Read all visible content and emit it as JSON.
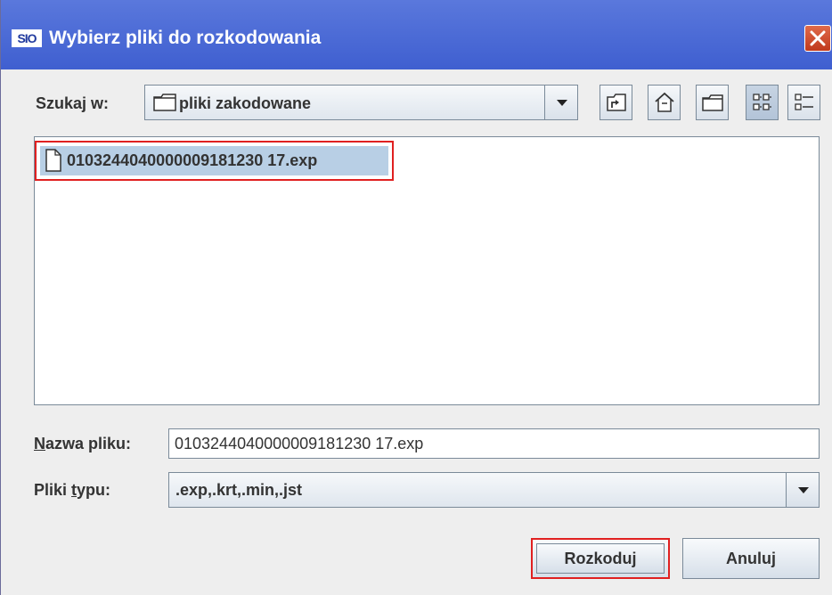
{
  "window": {
    "app_icon_text": "SIO",
    "title": "Wybierz pliki do rozkodowania"
  },
  "lookin": {
    "label": "Szukaj w:",
    "value": "pliki zakodowane"
  },
  "toolbar": {
    "icons": [
      "up-folder-icon",
      "home-icon",
      "new-folder-icon",
      "list-view-icon",
      "details-view-icon"
    ]
  },
  "file_list": {
    "items": [
      {
        "name": "0103244040000009181230 17.exp",
        "selected": true
      }
    ]
  },
  "filename": {
    "label_underlined": "N",
    "label_rest": "azwa pliku:",
    "value": "0103244040000009181230 17.exp"
  },
  "filetype": {
    "label_before": "Pliki ",
    "label_underlined": "t",
    "label_after": "ypu:",
    "value": ".exp,.krt,.min,.jst"
  },
  "buttons": {
    "decode": "Rozkoduj",
    "cancel": "Anuluj"
  },
  "colors": {
    "titlebar": "#4a6ad6",
    "selection": "#b8cfe5",
    "highlight_border": "#e02020",
    "panel": "#eeeeee"
  }
}
